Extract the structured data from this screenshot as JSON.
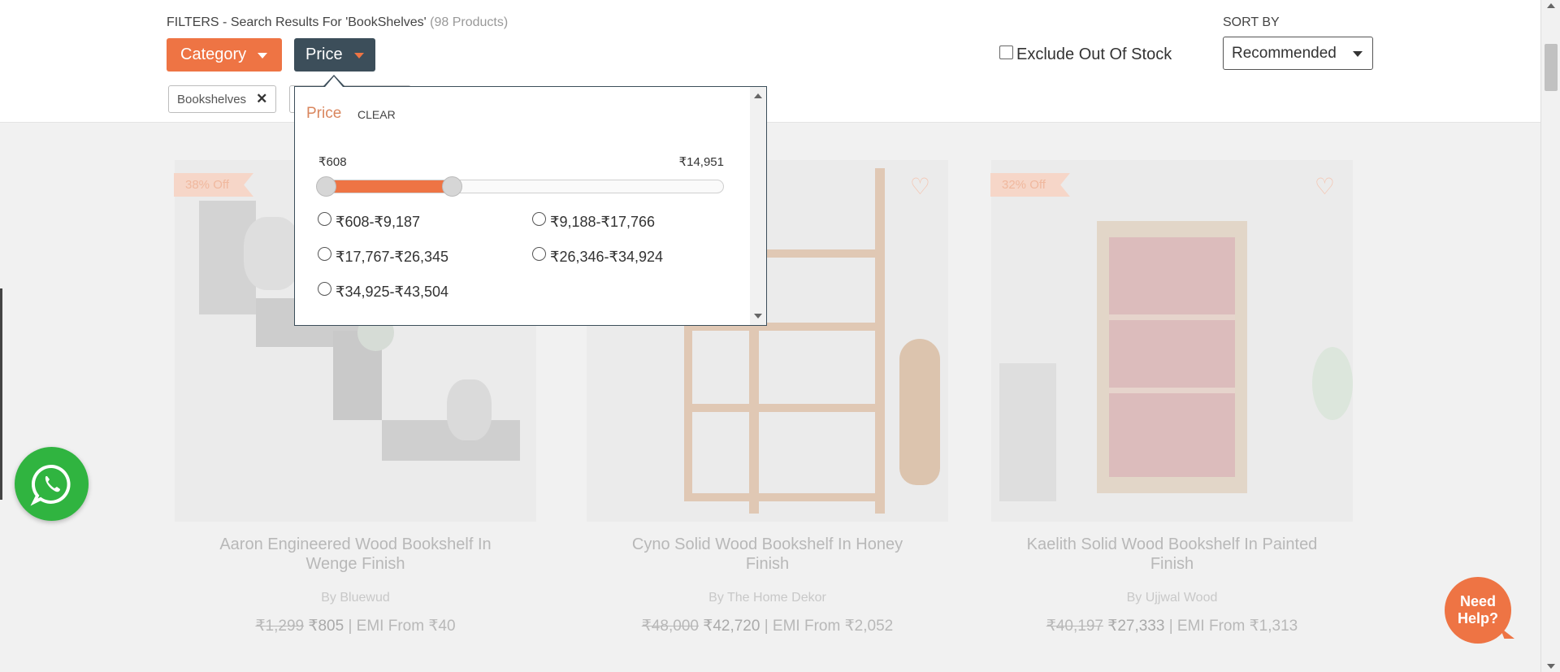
{
  "filters": {
    "title": "FILTERS - Search Results For 'BookShelves'",
    "count": "(98 Products)",
    "category_label": "Category",
    "price_label": "Price",
    "applied_chip": "Bookshelves",
    "exclude_out_of_stock": "Exclude Out Of Stock"
  },
  "sort": {
    "label": "SORT BY",
    "selected": "Recommended"
  },
  "price_panel": {
    "title": "Price",
    "clear": "CLEAR",
    "min_label": "₹608",
    "max_label": "₹14,951",
    "range_fill_fraction": 0.33,
    "options": [
      "₹608-₹9,187",
      "₹9,188-₹17,766",
      "₹17,767-₹26,345",
      "₹26,346-₹34,924",
      "₹34,925-₹43,504"
    ]
  },
  "products": [
    {
      "badge": "38% Off",
      "name": "Aaron Engineered Wood Bookshelf In Wenge Finish",
      "brand": "By Bluewud",
      "mrp": "₹1,299",
      "price": "₹805",
      "emi": "| EMI From ₹40"
    },
    {
      "badge": "",
      "name": "Cyno Solid Wood Bookshelf In Honey Finish",
      "brand": "By The Home Dekor",
      "mrp": "₹48,000",
      "price": "₹42,720",
      "emi": "| EMI From ₹2,052"
    },
    {
      "badge": "32% Off",
      "name": "Kaelith Solid Wood Bookshelf In Painted Finish",
      "brand": "By Ujjwal Wood",
      "mrp": "₹40,197",
      "price": "₹27,333",
      "emi": "| EMI From ₹1,313"
    }
  ],
  "help": {
    "need_help_line1": "Need",
    "need_help_line2": "Help?"
  },
  "colors": {
    "accent": "#ee7444",
    "dark_button": "#3c4e5a",
    "whatsapp": "#30b440"
  },
  "icons": [
    "caret-down-icon",
    "close-icon",
    "heart-icon",
    "whatsapp-icon",
    "chat-icon"
  ]
}
